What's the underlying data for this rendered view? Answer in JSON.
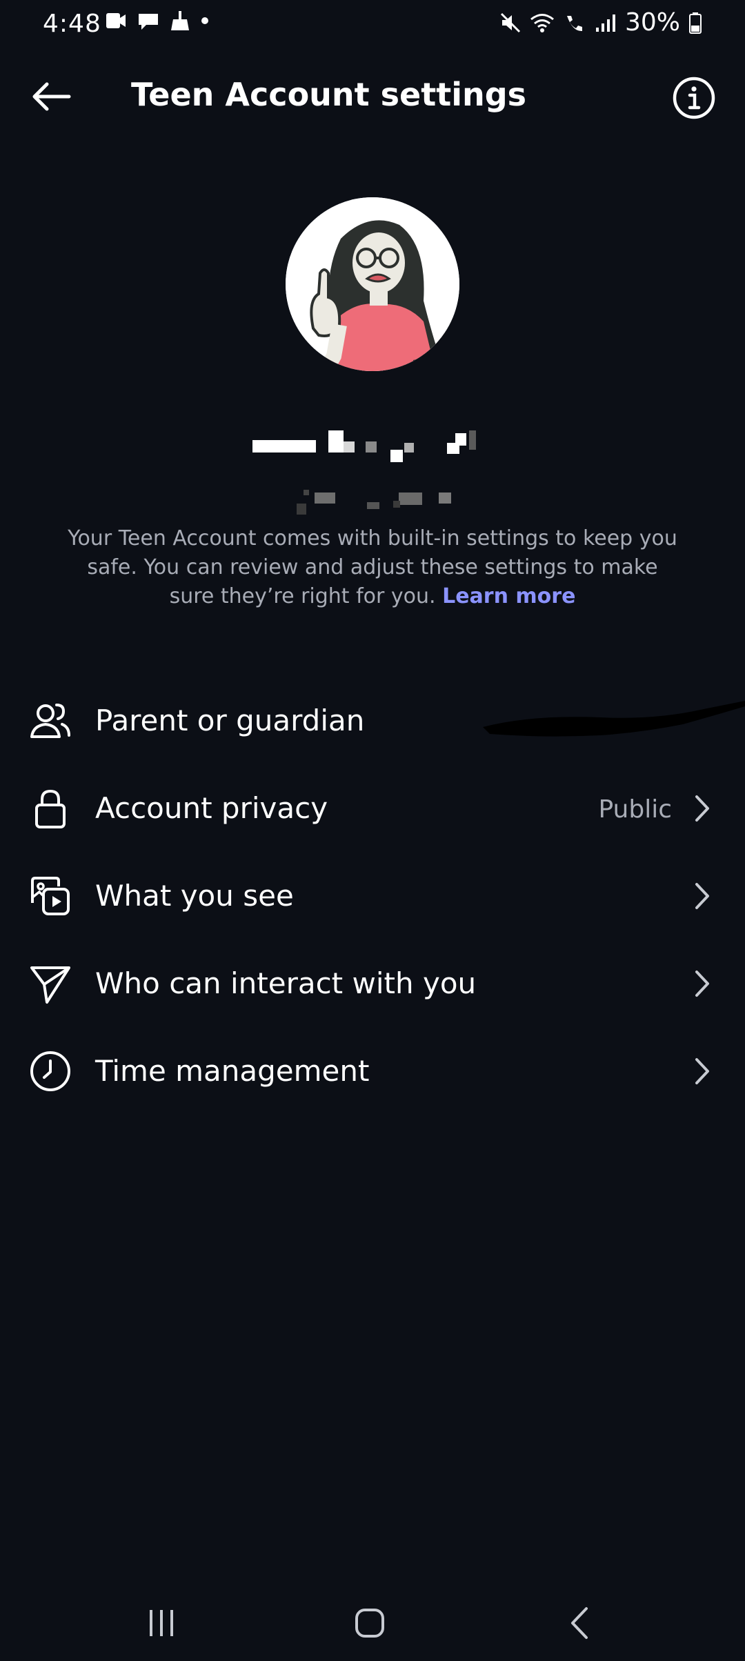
{
  "status_bar": {
    "time": "4:48",
    "battery_text": "30%",
    "left_icons": [
      "screen-record-icon",
      "chat-bubble-icon",
      "broom-icon",
      "dot-icon"
    ],
    "right_icons": [
      "mute-icon",
      "wifi-icon",
      "wifi-call-icon",
      "signal-icon",
      "battery-icon"
    ]
  },
  "header": {
    "title": "Teen Account settings",
    "back_icon": "arrow-left-icon",
    "info_icon": "info-icon"
  },
  "profile": {
    "username": "",
    "full_name": ""
  },
  "description": {
    "text": "Your Teen Account comes with built-in settings to keep you safe. You can review and adjust these settings to make sure they’re right for you.",
    "link": "Learn more"
  },
  "settings": [
    {
      "label": "Parent or guardian",
      "icon": "person-add-icon",
      "value": ""
    },
    {
      "label": "Account privacy",
      "icon": "lock-icon",
      "value": "Public"
    },
    {
      "label": "What you see",
      "icon": "media-icon",
      "value": ""
    },
    {
      "label": "Who can interact with you",
      "icon": "send-icon",
      "value": ""
    },
    {
      "label": "Time management",
      "icon": "clock-icon",
      "value": ""
    }
  ],
  "colors": {
    "background": "#0c0f16",
    "text_primary": "#ffffff",
    "text_secondary": "#a8acb6",
    "link": "#8b93ff"
  }
}
